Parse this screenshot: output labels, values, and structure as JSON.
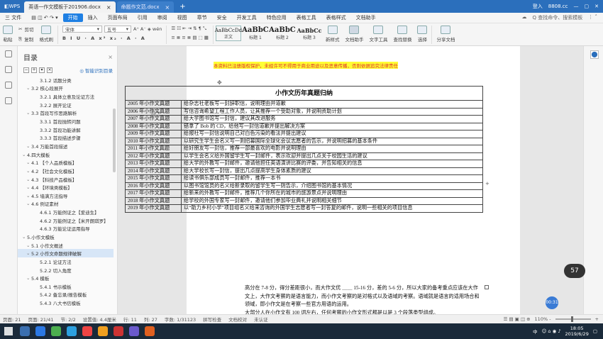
{
  "titlebar": {
    "app": "WPS",
    "tabs": [
      "英语一作文模板于201906.docx",
      "命题作文范.docx"
    ],
    "signin": "登入",
    "user": "8808.cc"
  },
  "menu": {
    "file": "三 文件",
    "items": [
      "开始",
      "插入",
      "页面布局",
      "引用",
      "审阅",
      "视图",
      "章节",
      "安全",
      "开发工具",
      "特色应用",
      "表格工具",
      "表格样式",
      "文档助手"
    ],
    "search": "Q 查找命令、搜索模板"
  },
  "ribbon": {
    "paste": "粘贴",
    "cut": "剪切",
    "copy": "复制",
    "format_painter": "格式刷",
    "font": "宋体",
    "size": "五号",
    "styles": [
      {
        "sample": "AaBbCcDd",
        "label": "正文"
      },
      {
        "sample": "AaBbC",
        "label": "标题 1"
      },
      {
        "sample": "AaBbC",
        "label": "标题 2"
      },
      {
        "sample": "AaBbCc",
        "label": "标题 3"
      }
    ],
    "new_style": "新样式",
    "doc_assist": "文档助手",
    "text_tools": "文字工具",
    "find_replace": "查找替换",
    "select": "选择",
    "share": "分享文档"
  },
  "toc": {
    "title": "目录",
    "smart": "智能识别目录",
    "items": [
      {
        "text": "3.1.2 话题分类",
        "level": 3
      },
      {
        "text": "3.2 核心段展开",
        "level": 2
      },
      {
        "text": "3.2.1 具体立意及论证方法",
        "level": 3
      },
      {
        "text": "3.2.2 展开论证",
        "level": 3
      },
      {
        "text": "3.3 首段写作思路解析",
        "level": 2
      },
      {
        "text": "3.3.1 首段抛转问题",
        "level": 3
      },
      {
        "text": "3.3.2 首段功能讲解",
        "level": 3
      },
      {
        "text": "3.3.3 首段描述步骤",
        "level": 3
      },
      {
        "text": "3.4 万能首段描述",
        "level": 2
      },
      {
        "text": "4.四大模板",
        "level": 1
      },
      {
        "text": "4.1 【个人品质模板】",
        "level": 2
      },
      {
        "text": "4.2 【社会文化模板】",
        "level": 2
      },
      {
        "text": "4.3 【科技产品模板】",
        "level": 2
      },
      {
        "text": "4.4 【环境类模板】",
        "level": 2
      },
      {
        "text": "4.5 墙满方法指导",
        "level": 2
      },
      {
        "text": "4.6 例证素材",
        "level": 2
      },
      {
        "text": "4.6.1 万能例证之【爱迪生】",
        "level": 3
      },
      {
        "text": "4.6.2 万能例证之【米开朗琪罗】",
        "level": 3
      },
      {
        "text": "4.6.3 万能论证运用指导",
        "level": 3
      },
      {
        "text": "5.小作文模板",
        "level": 1
      },
      {
        "text": "5.1 小作文概述",
        "level": 2
      },
      {
        "text": "5.2 小作文命题规律破解",
        "level": 2,
        "selected": true
      },
      {
        "text": "5.2.1 论证方法",
        "level": 3
      },
      {
        "text": "5.2.2 切入角度",
        "level": 3
      },
      {
        "text": "5.4 模板",
        "level": 2
      },
      {
        "text": "5.4.1 书示模板",
        "level": 3
      },
      {
        "text": "5.4.2 备忘录/报告模板",
        "level": 3
      },
      {
        "text": "5.4.3 八大书信模板",
        "level": 3
      }
    ]
  },
  "doc": {
    "notice": "本资料已注册版权保护，未经许可不得用于商业用途以及恶意传播，否则依据追究法律责任",
    "table_title": "小作文历年真题归纳",
    "rows": [
      {
        "year": "2005 年小作文真题",
        "desc": "给杂志社老板写一封辞职信，说明理由并道歉"
      },
      {
        "year": "2006 年小作文真题",
        "desc": "写信咨询希望工程工作人员，让其推荐一个受助对象，并说明资助计划"
      },
      {
        "year": "2007 年小作文真题",
        "desc": "给大学图书馆写一封信，建议其改进服务"
      },
      {
        "year": "2008 年小作文真题",
        "desc": "错拿了 Bob 的 CD，给他写一封信道歉并提出解决方案"
      },
      {
        "year": "2009 年小作文真题",
        "desc": "给报社写一封信说明自己对白色污染的看法并提出建议"
      },
      {
        "year": "2010 年小作文真题",
        "desc": "以研究生学生会名义写一则招募国际全球化会议志愿者的告示，并说明招募的基本条件"
      },
      {
        "year": "2011 年小作文真题",
        "desc": "给好朋友写一封信，推荐一部最喜欢的电影并说明理由"
      },
      {
        "year": "2012 年小作文真题",
        "desc": "以学生会名义给外国留学生写一封邮件，表示欢迎并提出几点关于校园生活的建议"
      },
      {
        "year": "2013 年小作文真题",
        "desc": "给大学的外教写一封邮件，邀请他担任英语演讲比赛的评委，并告知相关的信息"
      },
      {
        "year": "2014 年小作文真题",
        "desc": "给大学校长写一封信，提出几点提高学生身体素质的建议"
      },
      {
        "year": "2015 年小作文真题",
        "desc": "给读书俱乐部成员写一封邮件，推荐一本书"
      },
      {
        "year": "2016 年小作文真题",
        "desc": "以图书馆馆员的名义给新录取的留学生写一则告示，介绍图书馆的基本情况"
      },
      {
        "year": "2017 年小作文真题",
        "desc": "给新来的外教写一封邮件，推荐几个你所在的城市的旅游景点并说明理由"
      },
      {
        "year": "2018 年小作文真题",
        "desc": "给学校的外国专家写一封邮件，邀请他们参加毕业典礼并说明相关细节"
      },
      {
        "year": "2019 年小作文真题",
        "desc": "以“助力乡村小学”项目组名义给来咨询的外国学生志愿者写一封答复的邮件，说明一些相关的项目信息"
      }
    ],
    "para1": "高分在 7-8 分，得分差距很小，而大作文优 ＿＿ 15-16 分，差的 5-6 分，所以大家的备考重点应该在大作文上，大作文考察的是语言能力，而小作文考察的是对格式以及语域的考察。语域就是语言的适用场合和领域，即小作文是在考察一些官方用语的运用。",
    "para2": "大部分人在小作文有 100 词左右，任何考察的小作文形式都是以是 3 个段落类型组成。"
  },
  "status": {
    "page": "页面: 21",
    "pages": "页面: 21/41",
    "section": "节: 2/2",
    "setting": "设置值: 4.4厘米",
    "row": "行: 11",
    "col": "列: 27",
    "words": "字数: 1/31123",
    "spell": "拼写检查",
    "doc_check": "文档校对",
    "backup": "未认证",
    "zoom": "110% -"
  },
  "widgets": {
    "gauge": "57",
    "timer": "00:31"
  },
  "tray": {
    "time": "18:05",
    "date": "2019/6/29",
    "lang": "中"
  }
}
